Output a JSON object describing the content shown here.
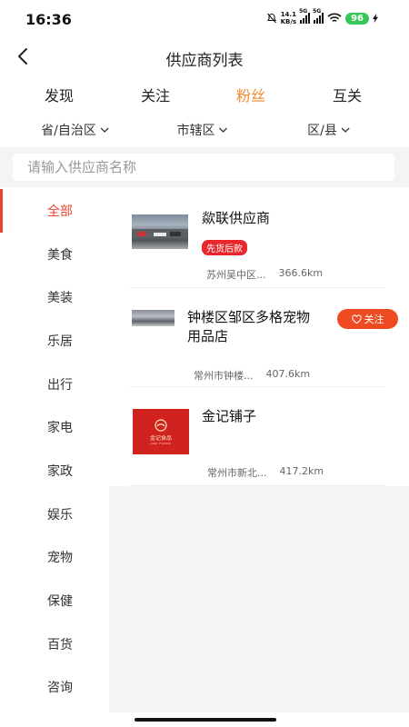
{
  "status_bar": {
    "time": "16:36",
    "net_speed_value": "14.1",
    "net_speed_unit": "KB/s",
    "sim1": "5G",
    "sim2": "5G",
    "battery": "96"
  },
  "header": {
    "title": "供应商列表"
  },
  "tabs": [
    {
      "label": "发现",
      "active": false
    },
    {
      "label": "关注",
      "active": false
    },
    {
      "label": "粉丝",
      "active": true
    },
    {
      "label": "互关",
      "active": false
    }
  ],
  "filters": [
    {
      "label": "省/自治区"
    },
    {
      "label": "市辖区"
    },
    {
      "label": "区/县"
    }
  ],
  "search": {
    "placeholder": "请输入供应商名称"
  },
  "sidebar": {
    "items": [
      {
        "label": "全部",
        "active": true
      },
      {
        "label": "美食"
      },
      {
        "label": "美装"
      },
      {
        "label": "乐居"
      },
      {
        "label": "出行"
      },
      {
        "label": "家电"
      },
      {
        "label": "家政"
      },
      {
        "label": "娱乐"
      },
      {
        "label": "宠物"
      },
      {
        "label": "保健"
      },
      {
        "label": "百货"
      },
      {
        "label": "咨询"
      }
    ]
  },
  "suppliers": [
    {
      "name": "歘联供应商",
      "tag": "先货后款",
      "location": "苏州吴中区...",
      "distance": "366.6km",
      "thumb": "street-photo"
    },
    {
      "name_line1": "钟楼区邹区多格宠物",
      "name_line2": "用品店",
      "location": "常州市钟楼...",
      "distance": "407.6km",
      "follow_label": "关注",
      "thumb": "shop-photo"
    },
    {
      "name": "金记铺子",
      "location": "常州市新北...",
      "distance": "417.2km",
      "thumb": "brand-logo",
      "logo_text": "金记食品",
      "logo_sub": "JINJI FOODS"
    }
  ],
  "colors": {
    "accent_orange": "#f08a2c",
    "accent_red": "#e8452c",
    "badge_red": "#e8262c",
    "follow_button": "#ef4b22",
    "battery_green": "#34c759"
  }
}
